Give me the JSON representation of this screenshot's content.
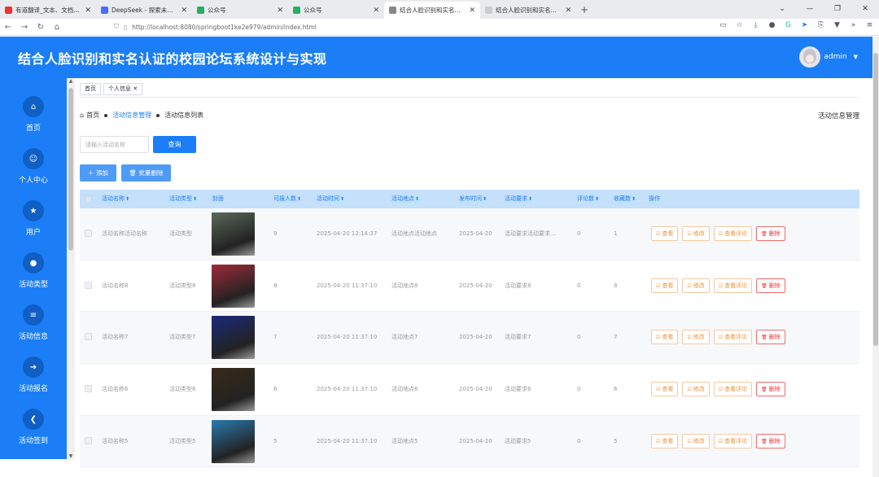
{
  "browser": {
    "tabs": [
      {
        "label": "有道翻译_文本、文档、网页、在",
        "color": "#e33",
        "active": false
      },
      {
        "label": "DeepSeek - 探索未至之境",
        "color": "#4d6bfe",
        "active": false
      },
      {
        "label": "公众号",
        "color": "#2aae67",
        "active": false
      },
      {
        "label": "公众号",
        "color": "#2aae67",
        "active": false
      },
      {
        "label": "结合人脸识别和实名认证的校园",
        "color": "#888",
        "active": true
      },
      {
        "label": "结合人脸识别和实名认证的校园论坛",
        "color": "#ccc",
        "active": false
      }
    ],
    "url": "http://localhost:8080/springboot1ke2e979/admin/index.html"
  },
  "app": {
    "title": "结合人脸识别和实名认证的校园论坛系统设计与实现",
    "user": "admin"
  },
  "sidebar": {
    "items": [
      {
        "label": "首页",
        "icon": "⌂"
      },
      {
        "label": "个人中心",
        "icon": "☺"
      },
      {
        "label": "用户",
        "icon": "★"
      },
      {
        "label": "活动类型",
        "icon": "●"
      },
      {
        "label": "活动信息",
        "icon": "≡"
      },
      {
        "label": "活动报名",
        "icon": "➔"
      },
      {
        "label": "活动签到",
        "icon": "❮"
      }
    ]
  },
  "page_tabs": [
    "首页",
    "个人信息"
  ],
  "breadcrumb": {
    "home": "首页",
    "section": "活动信息管理",
    "current": "活动信息列表"
  },
  "page_heading": "活动信息管理",
  "search": {
    "placeholder": "请输入活动名称",
    "button": "查询"
  },
  "actions": {
    "add": "添加",
    "batch_delete": "批量删除"
  },
  "table": {
    "headers": [
      "活动名称",
      "活动类型",
      "封面",
      "可报人数",
      "活动时间",
      "活动地点",
      "发布时间",
      "活动要求",
      "评论数",
      "收藏数",
      "操作"
    ],
    "op_labels": {
      "view": "查看",
      "edit": "修改",
      "comments": "查看评论",
      "delete": "删除"
    },
    "rows": [
      {
        "name": "活动名称活动名称",
        "type": "活动类型",
        "quota": "9",
        "time": "2025-04-20 12:14:37",
        "place": "活动地点活动地点",
        "publish": "2025-04-20",
        "req": "活动要求活动要求...",
        "comments": "0",
        "favs": "1",
        "cover": "#5a6a5a"
      },
      {
        "name": "活动名称8",
        "type": "活动类型8",
        "quota": "8",
        "time": "2025-04-20 11:37:10",
        "place": "活动地点8",
        "publish": "2025-04-20",
        "req": "活动要求8",
        "comments": "0",
        "favs": "8",
        "cover": "#a02a3a"
      },
      {
        "name": "活动名称7",
        "type": "活动类型7",
        "quota": "7",
        "time": "2025-04-20 11:37:10",
        "place": "活动地点7",
        "publish": "2025-04-20",
        "req": "活动要求7",
        "comments": "0",
        "favs": "7",
        "cover": "#1c2a7a"
      },
      {
        "name": "活动名称6",
        "type": "活动类型6",
        "quota": "6",
        "time": "2025-04-20 11:37:10",
        "place": "活动地点6",
        "publish": "2025-04-20",
        "req": "活动要求6",
        "comments": "0",
        "favs": "6",
        "cover": "#3a2a1a"
      },
      {
        "name": "活动名称5",
        "type": "活动类型5",
        "quota": "5",
        "time": "2025-04-20 11:37:10",
        "place": "活动地点5",
        "publish": "2025-04-20",
        "req": "活动要求5",
        "comments": "0",
        "favs": "5",
        "cover": "#2a7ab0"
      }
    ]
  }
}
